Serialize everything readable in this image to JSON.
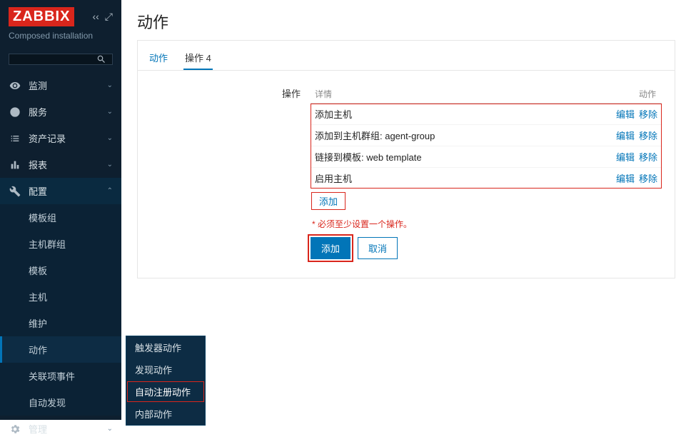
{
  "brand": {
    "name": "ZABBIX",
    "subtitle": "Composed installation"
  },
  "sidebar": {
    "items": [
      {
        "label": "监测",
        "icon": "eye"
      },
      {
        "label": "服务",
        "icon": "clock"
      },
      {
        "label": "资产记录",
        "icon": "list"
      },
      {
        "label": "报表",
        "icon": "chart"
      },
      {
        "label": "配置",
        "icon": "wrench",
        "expanded": true,
        "sub": [
          {
            "label": "模板组"
          },
          {
            "label": "主机群组"
          },
          {
            "label": "模板"
          },
          {
            "label": "主机"
          },
          {
            "label": "维护"
          },
          {
            "label": "动作",
            "active": true,
            "flyout": [
              {
                "label": "触发器动作"
              },
              {
                "label": "发现动作"
              },
              {
                "label": "自动注册动作",
                "active": true
              },
              {
                "label": "内部动作"
              }
            ]
          },
          {
            "label": "关联项事件"
          },
          {
            "label": "自动发现"
          }
        ]
      },
      {
        "label": "管理",
        "icon": "gear"
      }
    ]
  },
  "page": {
    "title": "动作",
    "tabs": [
      {
        "label": "动作"
      },
      {
        "label": "操作 4",
        "active": true
      }
    ],
    "form": {
      "section_label": "操作",
      "columns": {
        "details": "详情",
        "action": "动作"
      },
      "rows": [
        {
          "details": "添加主机",
          "edit": "编辑",
          "remove": "移除"
        },
        {
          "details": "添加到主机群组: agent-group",
          "edit": "编辑",
          "remove": "移除"
        },
        {
          "details": "链接到模板: web template",
          "edit": "编辑",
          "remove": "移除"
        },
        {
          "details": "启用主机",
          "edit": "编辑",
          "remove": "移除"
        }
      ],
      "add_op": "添加",
      "required_msg": "* 必须至少设置一个操作。",
      "submit": "添加",
      "cancel": "取消"
    }
  }
}
